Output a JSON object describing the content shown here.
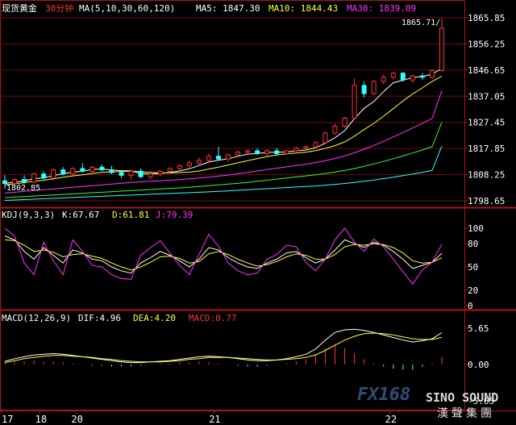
{
  "chart_data": [
    {
      "type": "candlestick",
      "title": "现货黄金",
      "timeframe": "30分钟",
      "ma_label": "MA(5,10,30,60,120)",
      "ma_values": [
        {
          "name": "MA5",
          "text": "MA5: 1847.30",
          "color": "#ffffff"
        },
        {
          "name": "MA10",
          "text": "MA10: 1844.43",
          "color": "#ffff33"
        },
        {
          "name": "MA30",
          "text": "MA30: 1839.09",
          "color": "#ff33ff"
        }
      ],
      "y_ticks": [
        "1865.85",
        "1856.25",
        "1846.65",
        "1837.05",
        "1827.45",
        "1817.85",
        "1808.25",
        "1798.65"
      ],
      "ylim": [
        1798.65,
        1865.85
      ],
      "high_label": "1865.71",
      "low_label": "1802.85",
      "x_ticks": [
        "17",
        "18",
        "20",
        "21",
        "22"
      ],
      "ohlc": [
        [
          1806.0,
          1808.0,
          1803.0,
          1805.0
        ],
        [
          1805.0,
          1807.0,
          1804.0,
          1806.5
        ],
        [
          1806.5,
          1808.0,
          1805.0,
          1805.5
        ],
        [
          1805.5,
          1809.0,
          1805.0,
          1808.5
        ],
        [
          1808.5,
          1809.5,
          1806.5,
          1807.0
        ],
        [
          1807.0,
          1810.5,
          1806.0,
          1810.0
        ],
        [
          1810.0,
          1811.0,
          1808.0,
          1808.5
        ],
        [
          1808.5,
          1811.0,
          1807.5,
          1810.5
        ],
        [
          1810.5,
          1812.5,
          1809.0,
          1809.5
        ],
        [
          1809.5,
          1811.5,
          1808.5,
          1811.0
        ],
        [
          1811.0,
          1812.0,
          1809.5,
          1810.0
        ],
        [
          1810.0,
          1811.5,
          1808.5,
          1809.0
        ],
        [
          1809.0,
          1810.0,
          1807.0,
          1808.0
        ],
        [
          1808.0,
          1810.0,
          1806.5,
          1809.5
        ],
        [
          1809.5,
          1810.5,
          1807.0,
          1807.5
        ],
        [
          1807.5,
          1809.0,
          1806.5,
          1808.5
        ],
        [
          1808.5,
          1810.0,
          1807.5,
          1809.5
        ],
        [
          1809.5,
          1811.0,
          1808.5,
          1810.5
        ],
        [
          1810.5,
          1812.0,
          1809.5,
          1811.5
        ],
        [
          1811.5,
          1813.5,
          1810.5,
          1812.5
        ],
        [
          1812.5,
          1814.5,
          1811.5,
          1813.5
        ],
        [
          1813.5,
          1816.0,
          1812.5,
          1815.0
        ],
        [
          1815.0,
          1818.5,
          1813.5,
          1814.0
        ],
        [
          1814.0,
          1816.0,
          1813.0,
          1815.5
        ],
        [
          1815.5,
          1817.0,
          1814.5,
          1816.5
        ],
        [
          1816.5,
          1817.5,
          1815.5,
          1817.0
        ],
        [
          1817.0,
          1818.0,
          1815.5,
          1816.0
        ],
        [
          1816.0,
          1817.5,
          1815.0,
          1817.0
        ],
        [
          1817.0,
          1818.0,
          1815.5,
          1816.0
        ],
        [
          1816.0,
          1817.5,
          1815.5,
          1817.0
        ],
        [
          1817.0,
          1818.5,
          1816.0,
          1818.0
        ],
        [
          1818.0,
          1819.0,
          1817.5,
          1818.5
        ],
        [
          1818.5,
          1820.5,
          1818.0,
          1820.0
        ],
        [
          1820.0,
          1824.0,
          1819.5,
          1823.5
        ],
        [
          1823.5,
          1827.0,
          1823.0,
          1826.0
        ],
        [
          1826.0,
          1829.5,
          1825.5,
          1829.0
        ],
        [
          1829.0,
          1843.5,
          1828.5,
          1841.0
        ],
        [
          1841.0,
          1842.5,
          1836.5,
          1838.0
        ],
        [
          1838.0,
          1843.0,
          1837.5,
          1842.5
        ],
        [
          1842.5,
          1845.0,
          1841.5,
          1844.0
        ],
        [
          1844.0,
          1846.0,
          1843.0,
          1845.5
        ],
        [
          1845.5,
          1846.0,
          1842.5,
          1843.0
        ],
        [
          1843.0,
          1845.0,
          1842.0,
          1844.5
        ],
        [
          1844.5,
          1845.5,
          1843.0,
          1844.0
        ],
        [
          1844.0,
          1847.0,
          1843.5,
          1846.5
        ],
        [
          1846.5,
          1865.71,
          1846.0,
          1862.0
        ]
      ],
      "ma_series": [
        {
          "name": "MA5",
          "color": "#ffffff",
          "values": [
            1805.0,
            1805.5,
            1806.0,
            1806.8,
            1807.1,
            1807.9,
            1808.6,
            1809.2,
            1809.5,
            1810.2,
            1810.3,
            1810.0,
            1809.7,
            1809.7,
            1808.6,
            1808.5,
            1808.7,
            1809.1,
            1809.6,
            1810.4,
            1811.6,
            1812.9,
            1813.5,
            1814.1,
            1815.0,
            1815.8,
            1816.0,
            1816.4,
            1816.5,
            1816.6,
            1817.0,
            1817.3,
            1818.1,
            1819.8,
            1821.8,
            1824.4,
            1828.8,
            1832.6,
            1835.1,
            1838.7,
            1842.0,
            1842.9,
            1843.9,
            1844.3,
            1845.1,
            1847.3
          ]
        },
        {
          "name": "MA10",
          "color": "#ffff33",
          "values": [
            1804.5,
            1804.9,
            1805.3,
            1805.8,
            1806.2,
            1806.7,
            1807.3,
            1807.8,
            1808.2,
            1808.7,
            1809.1,
            1809.3,
            1809.4,
            1809.5,
            1809.3,
            1809.1,
            1808.9,
            1808.9,
            1809.0,
            1809.2,
            1809.6,
            1810.3,
            1811.0,
            1811.8,
            1812.6,
            1813.4,
            1814.1,
            1814.9,
            1815.5,
            1815.9,
            1816.2,
            1816.5,
            1817.1,
            1817.9,
            1818.9,
            1820.3,
            1822.4,
            1824.8,
            1827.1,
            1829.7,
            1832.5,
            1835.3,
            1837.9,
            1840.1,
            1842.5,
            1844.43
          ]
        },
        {
          "name": "MA30",
          "color": "#ff33ff",
          "values": [
            1801.5,
            1801.8,
            1802.1,
            1802.4,
            1802.7,
            1803.0,
            1803.3,
            1803.6,
            1803.9,
            1804.2,
            1804.5,
            1804.8,
            1805.1,
            1805.4,
            1805.6,
            1805.8,
            1806.0,
            1806.2,
            1806.4,
            1806.7,
            1807.0,
            1807.3,
            1807.7,
            1808.1,
            1808.6,
            1809.1,
            1809.6,
            1810.1,
            1810.6,
            1811.1,
            1811.6,
            1812.1,
            1812.7,
            1813.4,
            1814.2,
            1815.1,
            1816.3,
            1817.6,
            1819.0,
            1820.5,
            1822.1,
            1823.7,
            1825.4,
            1827.1,
            1828.9,
            1839.09
          ]
        },
        {
          "name": "MA60",
          "color": "#33ff33",
          "values": [
            1799.8,
            1800.0,
            1800.2,
            1800.4,
            1800.6,
            1800.8,
            1801.0,
            1801.2,
            1801.4,
            1801.6,
            1801.8,
            1802.0,
            1802.2,
            1802.4,
            1802.6,
            1802.8,
            1803.0,
            1803.2,
            1803.4,
            1803.6,
            1803.9,
            1804.2,
            1804.5,
            1804.8,
            1805.1,
            1805.4,
            1805.8,
            1806.2,
            1806.6,
            1807.0,
            1807.4,
            1807.8,
            1808.2,
            1808.7,
            1809.2,
            1809.8,
            1810.5,
            1811.3,
            1812.2,
            1813.1,
            1814.1,
            1815.1,
            1816.2,
            1817.3,
            1818.5,
            1827.5
          ]
        },
        {
          "name": "MA120",
          "color": "#33ffff",
          "values": [
            1798.8,
            1798.95,
            1799.1,
            1799.25,
            1799.4,
            1799.55,
            1799.7,
            1799.85,
            1800.0,
            1800.15,
            1800.3,
            1800.45,
            1800.6,
            1800.75,
            1800.9,
            1801.05,
            1801.2,
            1801.35,
            1801.5,
            1801.65,
            1801.8,
            1801.95,
            1802.1,
            1802.3,
            1802.5,
            1802.7,
            1802.9,
            1803.1,
            1803.3,
            1803.5,
            1803.7,
            1803.9,
            1804.1,
            1804.4,
            1804.7,
            1805.0,
            1805.4,
            1805.8,
            1806.3,
            1806.8,
            1807.3,
            1807.9,
            1808.5,
            1809.1,
            1809.8,
            1818.8
          ]
        }
      ]
    },
    {
      "type": "line",
      "title": "KDJ(9,3,3)",
      "readings": [
        {
          "text": "K:67.67",
          "color": "#ffffff"
        },
        {
          "text": "D:61.81",
          "color": "#ffff33"
        },
        {
          "text": "J:79.39",
          "color": "#ff33ff"
        }
      ],
      "y_ticks": [
        "100",
        "80",
        "50",
        "20",
        "0"
      ],
      "ylim": [
        0,
        100
      ],
      "series": [
        {
          "name": "K",
          "color": "#ffffff",
          "values": [
            90,
            85,
            70,
            60,
            75,
            65,
            55,
            72,
            68,
            60,
            58,
            50,
            45,
            42,
            55,
            62,
            70,
            65,
            58,
            50,
            60,
            75,
            72,
            62,
            55,
            50,
            48,
            55,
            60,
            68,
            70,
            62,
            55,
            60,
            72,
            85,
            80,
            75,
            82,
            78,
            70,
            60,
            48,
            52,
            56,
            67.67
          ]
        },
        {
          "name": "D",
          "color": "#ffff33",
          "values": [
            85,
            84,
            78,
            70,
            72,
            69,
            63,
            66,
            67,
            64,
            61,
            55,
            50,
            46,
            50,
            56,
            63,
            64,
            61,
            55,
            57,
            67,
            70,
            66,
            60,
            55,
            51,
            53,
            57,
            63,
            67,
            65,
            60,
            60,
            66,
            76,
            79,
            78,
            80,
            79,
            75,
            68,
            58,
            55,
            56,
            61.81
          ]
        },
        {
          "name": "J",
          "color": "#ff33ff",
          "values": [
            100,
            90,
            55,
            40,
            82,
            58,
            40,
            85,
            70,
            52,
            50,
            40,
            35,
            34,
            65,
            75,
            84,
            68,
            52,
            40,
            66,
            92,
            77,
            55,
            45,
            40,
            42,
            60,
            66,
            78,
            76,
            56,
            45,
            60,
            85,
            100,
            82,
            70,
            86,
            76,
            60,
            44,
            28,
            46,
            56,
            79.39
          ]
        }
      ]
    },
    {
      "type": "line",
      "title": "MACD(12,26,9)",
      "readings": [
        {
          "text": "DIF:4.96",
          "color": "#ffffff"
        },
        {
          "text": "DEA:4.20",
          "color": "#ffff33"
        },
        {
          "text": "MACD:0.77",
          "color": "#ff3333"
        }
      ],
      "y_ticks": [
        "5.65",
        "0.00",
        "-5.65"
      ],
      "ylim": [
        -5.65,
        5.65
      ],
      "series": [
        {
          "name": "DIF",
          "color": "#ffffff",
          "values": [
            0.5,
            0.9,
            1.2,
            1.5,
            1.6,
            1.7,
            1.6,
            1.4,
            1.2,
            1.0,
            0.8,
            0.6,
            0.4,
            0.3,
            0.3,
            0.4,
            0.5,
            0.6,
            0.8,
            1.0,
            1.2,
            1.3,
            1.2,
            1.1,
            0.9,
            0.7,
            0.6,
            0.6,
            0.7,
            0.9,
            1.2,
            1.6,
            2.4,
            3.8,
            5.0,
            5.4,
            5.5,
            5.3,
            5.0,
            4.6,
            4.2,
            3.8,
            3.5,
            3.7,
            4.0,
            4.96
          ]
        },
        {
          "name": "DEA",
          "color": "#ffff33",
          "values": [
            0.3,
            0.6,
            0.9,
            1.1,
            1.3,
            1.4,
            1.4,
            1.3,
            1.2,
            1.1,
            0.9,
            0.8,
            0.6,
            0.5,
            0.4,
            0.4,
            0.4,
            0.5,
            0.6,
            0.8,
            0.9,
            1.1,
            1.1,
            1.1,
            1.0,
            0.9,
            0.8,
            0.7,
            0.7,
            0.8,
            0.9,
            1.1,
            1.5,
            2.2,
            3.0,
            3.8,
            4.4,
            4.8,
            4.9,
            4.8,
            4.6,
            4.3,
            4.0,
            3.9,
            3.9,
            4.2
          ]
        },
        {
          "name": "MACD",
          "color": "#ff3333",
          "values": [
            0.2,
            0.3,
            0.3,
            0.4,
            0.3,
            0.3,
            0.2,
            0.1,
            0.0,
            -0.1,
            -0.1,
            -0.2,
            -0.2,
            -0.2,
            -0.1,
            0.0,
            0.1,
            0.1,
            0.2,
            0.2,
            0.3,
            0.2,
            0.1,
            0.0,
            -0.1,
            -0.2,
            -0.2,
            -0.1,
            0.0,
            0.1,
            0.3,
            0.5,
            0.9,
            1.6,
            2.0,
            1.6,
            1.1,
            0.5,
            0.1,
            -0.2,
            -0.4,
            -0.5,
            -0.5,
            -0.2,
            0.1,
            0.77
          ]
        }
      ]
    }
  ],
  "watermark": {
    "brand": "FX168",
    "name": "SINO SOUND",
    "cn": "漢聲集團"
  }
}
